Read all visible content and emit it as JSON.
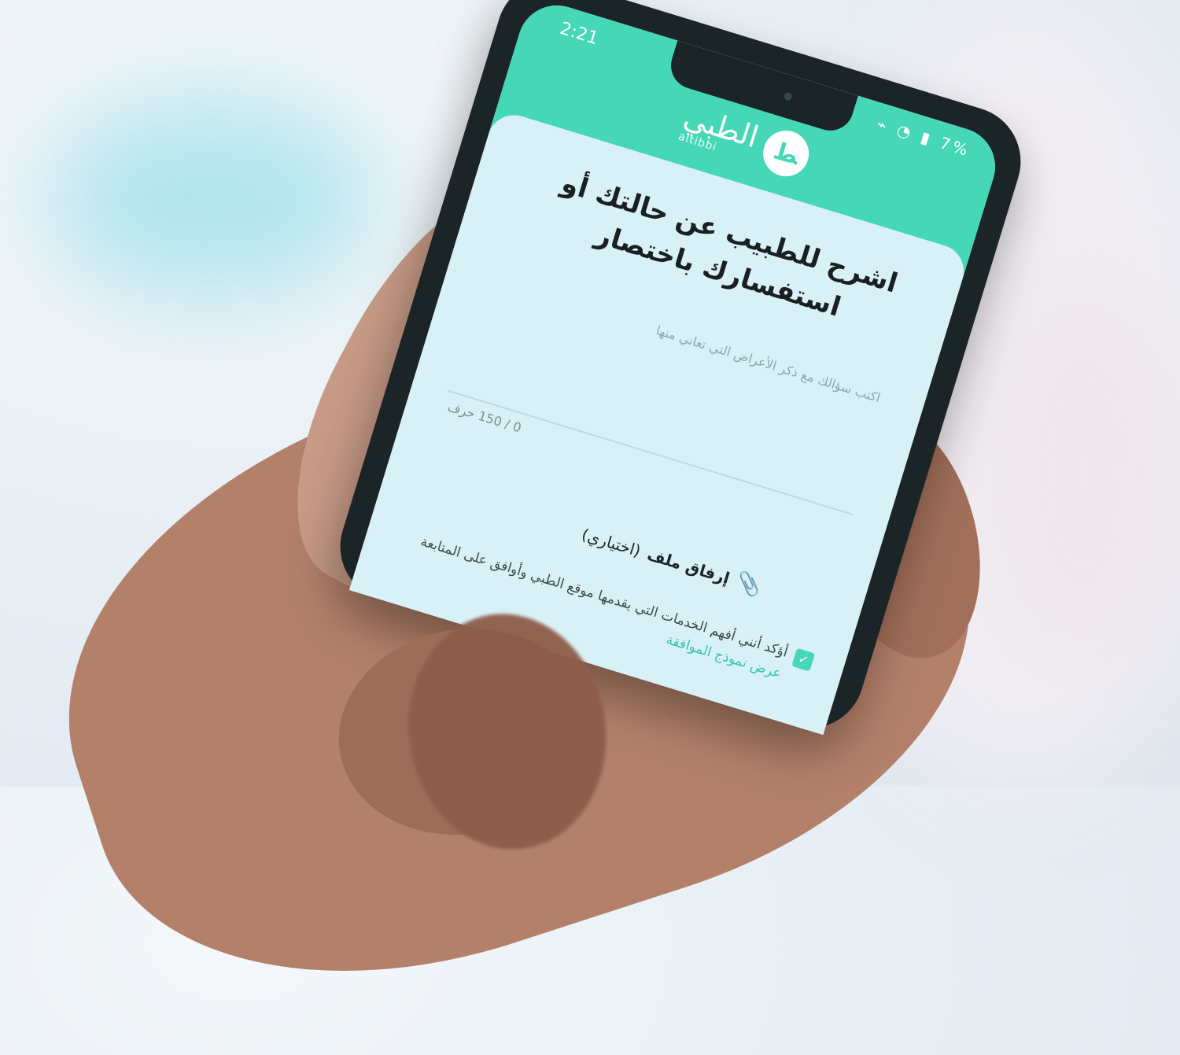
{
  "status": {
    "time": "2:21",
    "icons": "⌁ ◔ ▮ 7%"
  },
  "brand": {
    "arabic": "الطبي",
    "latin": "altibbi",
    "mark": "ﻂ"
  },
  "screen": {
    "title": "اشرح للطبيب عن حالتك أو استفسارك باختصار",
    "placeholder": "اكتب سؤالك مع ذكر الأعراض التي تعاني منها",
    "counter": "0 / 150 حرف",
    "attach_label": "إرفاق ملف",
    "attach_optional": "(اختياري)",
    "consent_text": "أؤكد أنني أفهم الخدمات التي يقدمها موقع الطبي وأوافق على المتابعة",
    "consent_link": "عرض نموذج الموافقة"
  },
  "colors": {
    "brand": "#46d7b6",
    "link": "#35c6a3"
  }
}
